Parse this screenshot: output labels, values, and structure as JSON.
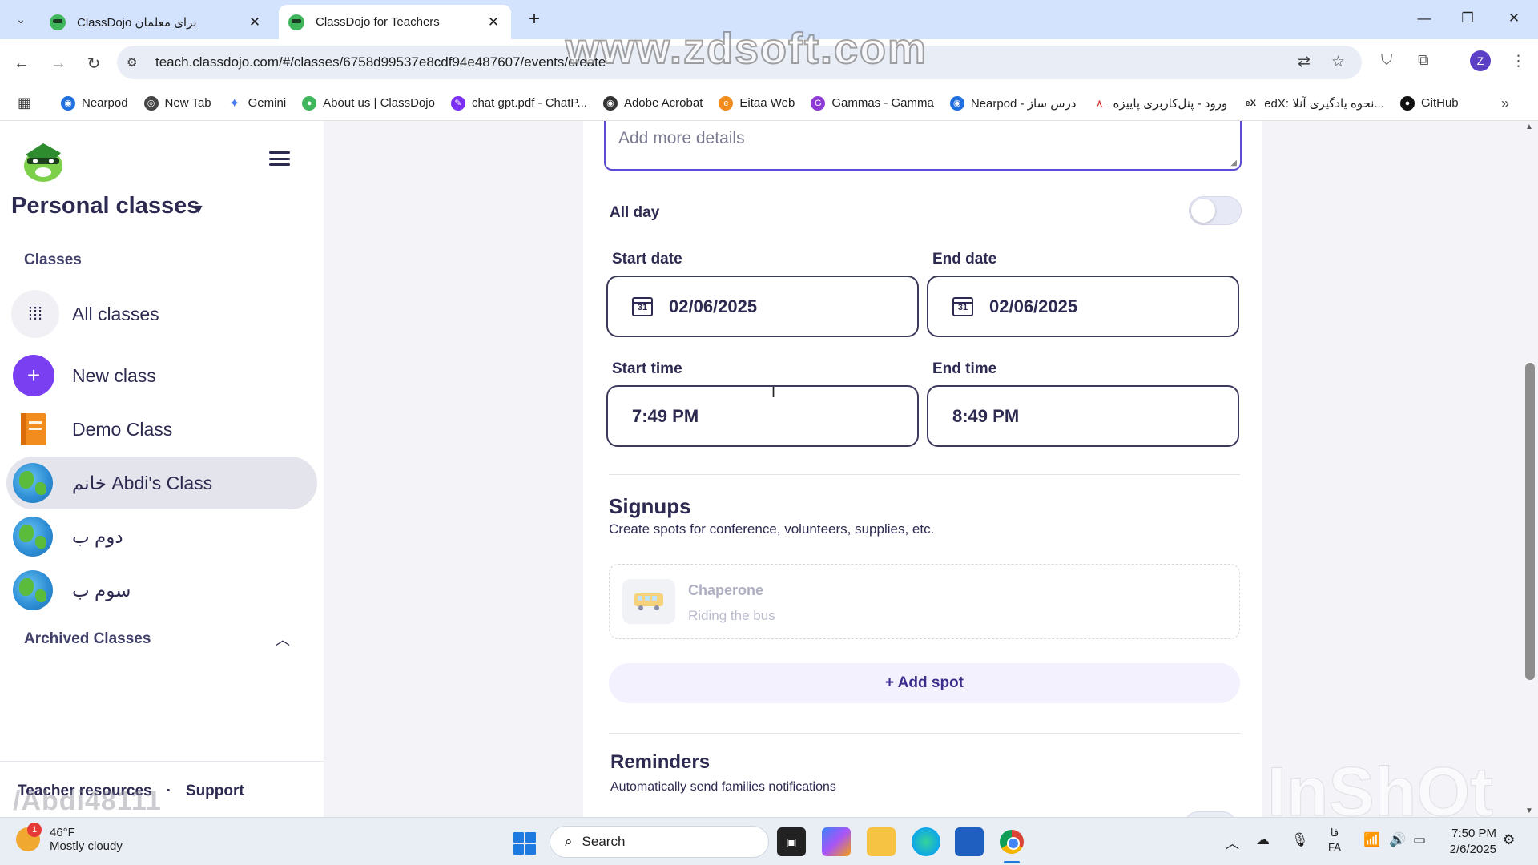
{
  "browser": {
    "tabs": [
      {
        "title": "ClassDojo برای معلمان",
        "active": false
      },
      {
        "title": "ClassDojo for Teachers",
        "active": true
      }
    ],
    "url": "teach.classdojo.com/#/classes/6758d99537e8cdf94e487607/events/create",
    "profile_initial": "Z",
    "bookmarks": [
      {
        "label": "Nearpod",
        "icon": "nearpod-icon",
        "color": "#1f6fe0"
      },
      {
        "label": "New Tab",
        "icon": "newtab-icon",
        "color": "#444444"
      },
      {
        "label": "Gemini",
        "icon": "gemini-icon",
        "color": "#4a7cf0"
      },
      {
        "label": "About us | ClassDojo",
        "icon": "classdojo-icon",
        "color": "#3fb55c"
      },
      {
        "label": "chat gpt.pdf - ChatP...",
        "icon": "pdf-icon",
        "color": "#7b2ff2"
      },
      {
        "label": "Adobe Acrobat",
        "icon": "acrobat-icon",
        "color": "#333333"
      },
      {
        "label": "Eitaa Web",
        "icon": "eitaa-icon",
        "color": "#f28c1e"
      },
      {
        "label": "Gammas - Gamma",
        "icon": "gamma-icon",
        "color": "#8e3bd6"
      },
      {
        "label": "Nearpod - درس ساز",
        "icon": "nearpod-icon",
        "color": "#1f6fe0"
      },
      {
        "label": "ورود - پنل‌کاربری پاییزه",
        "icon": "paeezeh-icon",
        "color": "#d32f2f"
      },
      {
        "label": "edX: نحوه یادگیری آنلا...",
        "icon": "edx-icon",
        "color": "#222222"
      },
      {
        "label": "GitHub",
        "icon": "github-icon",
        "color": "#111111"
      }
    ]
  },
  "watermarks": {
    "top": "www.zdsoft.com",
    "bottom_left": "/Abdi48111",
    "bottom_right": "InShOt"
  },
  "sidebar": {
    "title": "Personal classes",
    "section_label": "Classes",
    "items": [
      {
        "label": "All classes",
        "type": "grid"
      },
      {
        "label": "New class",
        "type": "plus"
      },
      {
        "label": "Demo Class",
        "type": "book"
      },
      {
        "label": "خانم Abdi's Class",
        "type": "globe",
        "selected": true,
        "notification": true
      },
      {
        "label": "دوم ب",
        "type": "globe"
      },
      {
        "label": "سوم ب",
        "type": "globe"
      }
    ],
    "archived_label": "Archived Classes",
    "footer": {
      "resources": "Teacher resources",
      "separator": "·",
      "support": "Support"
    }
  },
  "form": {
    "details_placeholder": "Add more details",
    "all_day_label": "All day",
    "all_day_on": false,
    "start_date_label": "Start date",
    "start_date": "02/06/2025",
    "end_date_label": "End date",
    "end_date": "02/06/2025",
    "calendar_day": "31",
    "start_time_label": "Start time",
    "start_time": "7:49 PM",
    "end_time_label": "End time",
    "end_time": "8:49 PM",
    "signups": {
      "title": "Signups",
      "subtitle": "Create spots for conference, volunteers, supplies, etc.",
      "example_title": "Chaperone",
      "example_subtitle": "Riding the bus",
      "add_spot": "+ Add spot"
    },
    "reminders": {
      "title": "Reminders",
      "subtitle": "Automatically send families notifications"
    }
  },
  "taskbar": {
    "weather_temp": "46°F",
    "weather_desc": "Mostly cloudy",
    "weather_badge": "1",
    "search_label": "Search",
    "lang_top": "فا",
    "lang_bottom": "FA",
    "time": "7:50 PM",
    "date": "2/6/2025"
  },
  "colors": {
    "accent": "#7b3ff2",
    "textarea_focus": "#5b4bd6",
    "sidebar_selected": "#e4e4ec",
    "notification": "#e8262f"
  }
}
